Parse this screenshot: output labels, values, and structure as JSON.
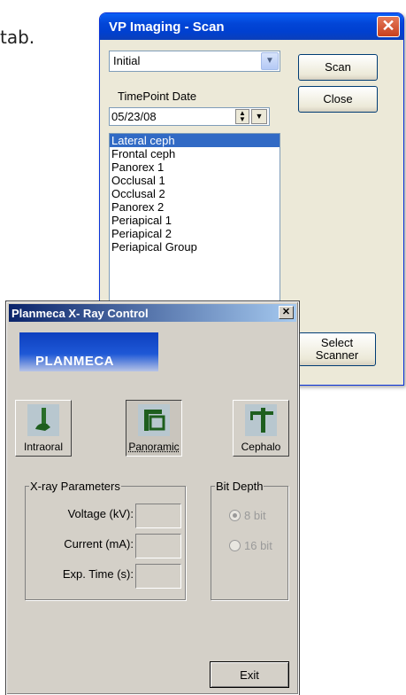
{
  "page": {
    "partial_text": "tab."
  },
  "vp_window": {
    "title": "VP Imaging - Scan",
    "close_glyph": "✕",
    "combo_value": "Initial",
    "scan_label": "Scan",
    "close_label": "Close",
    "timepoint_label": "TimePoint Date",
    "date_value": "05/23/08",
    "select_scanner_label": "Select Scanner",
    "list_items": [
      "Lateral ceph",
      "Frontal ceph",
      "Panorex 1",
      "Occlusal 1",
      "Occlusal 2",
      "Panorex 2",
      "Periapical 1",
      "Periapical 2",
      "Periapical Group"
    ],
    "selected_item": "Lateral ceph"
  },
  "pm_window": {
    "title": "Planmeca X- Ray Control",
    "close_glyph": "✕",
    "logo_text": "PLANMECA",
    "modes": [
      {
        "label": "Intraoral",
        "icon": "intraoral-icon",
        "pressed": false
      },
      {
        "label": "Panoramic",
        "icon": "panoramic-icon",
        "pressed": true
      },
      {
        "label": "Cephalo",
        "icon": "cephalo-icon",
        "pressed": false
      }
    ],
    "xray_params": {
      "legend": "X-ray Parameters",
      "voltage_label": "Voltage (kV):",
      "current_label": "Current (mA):",
      "exposure_label": "Exp. Time (s):"
    },
    "bit_depth": {
      "legend": "Bit Depth",
      "opt8": "8 bit",
      "opt16": "16 bit",
      "selected": "8 bit"
    },
    "exit_label": "Exit"
  },
  "colors": {
    "xp_title": "#0245d6",
    "list_selection": "#316ac5",
    "classic_face": "#d4d0c8",
    "logo_blue": "#0d3fbf"
  }
}
